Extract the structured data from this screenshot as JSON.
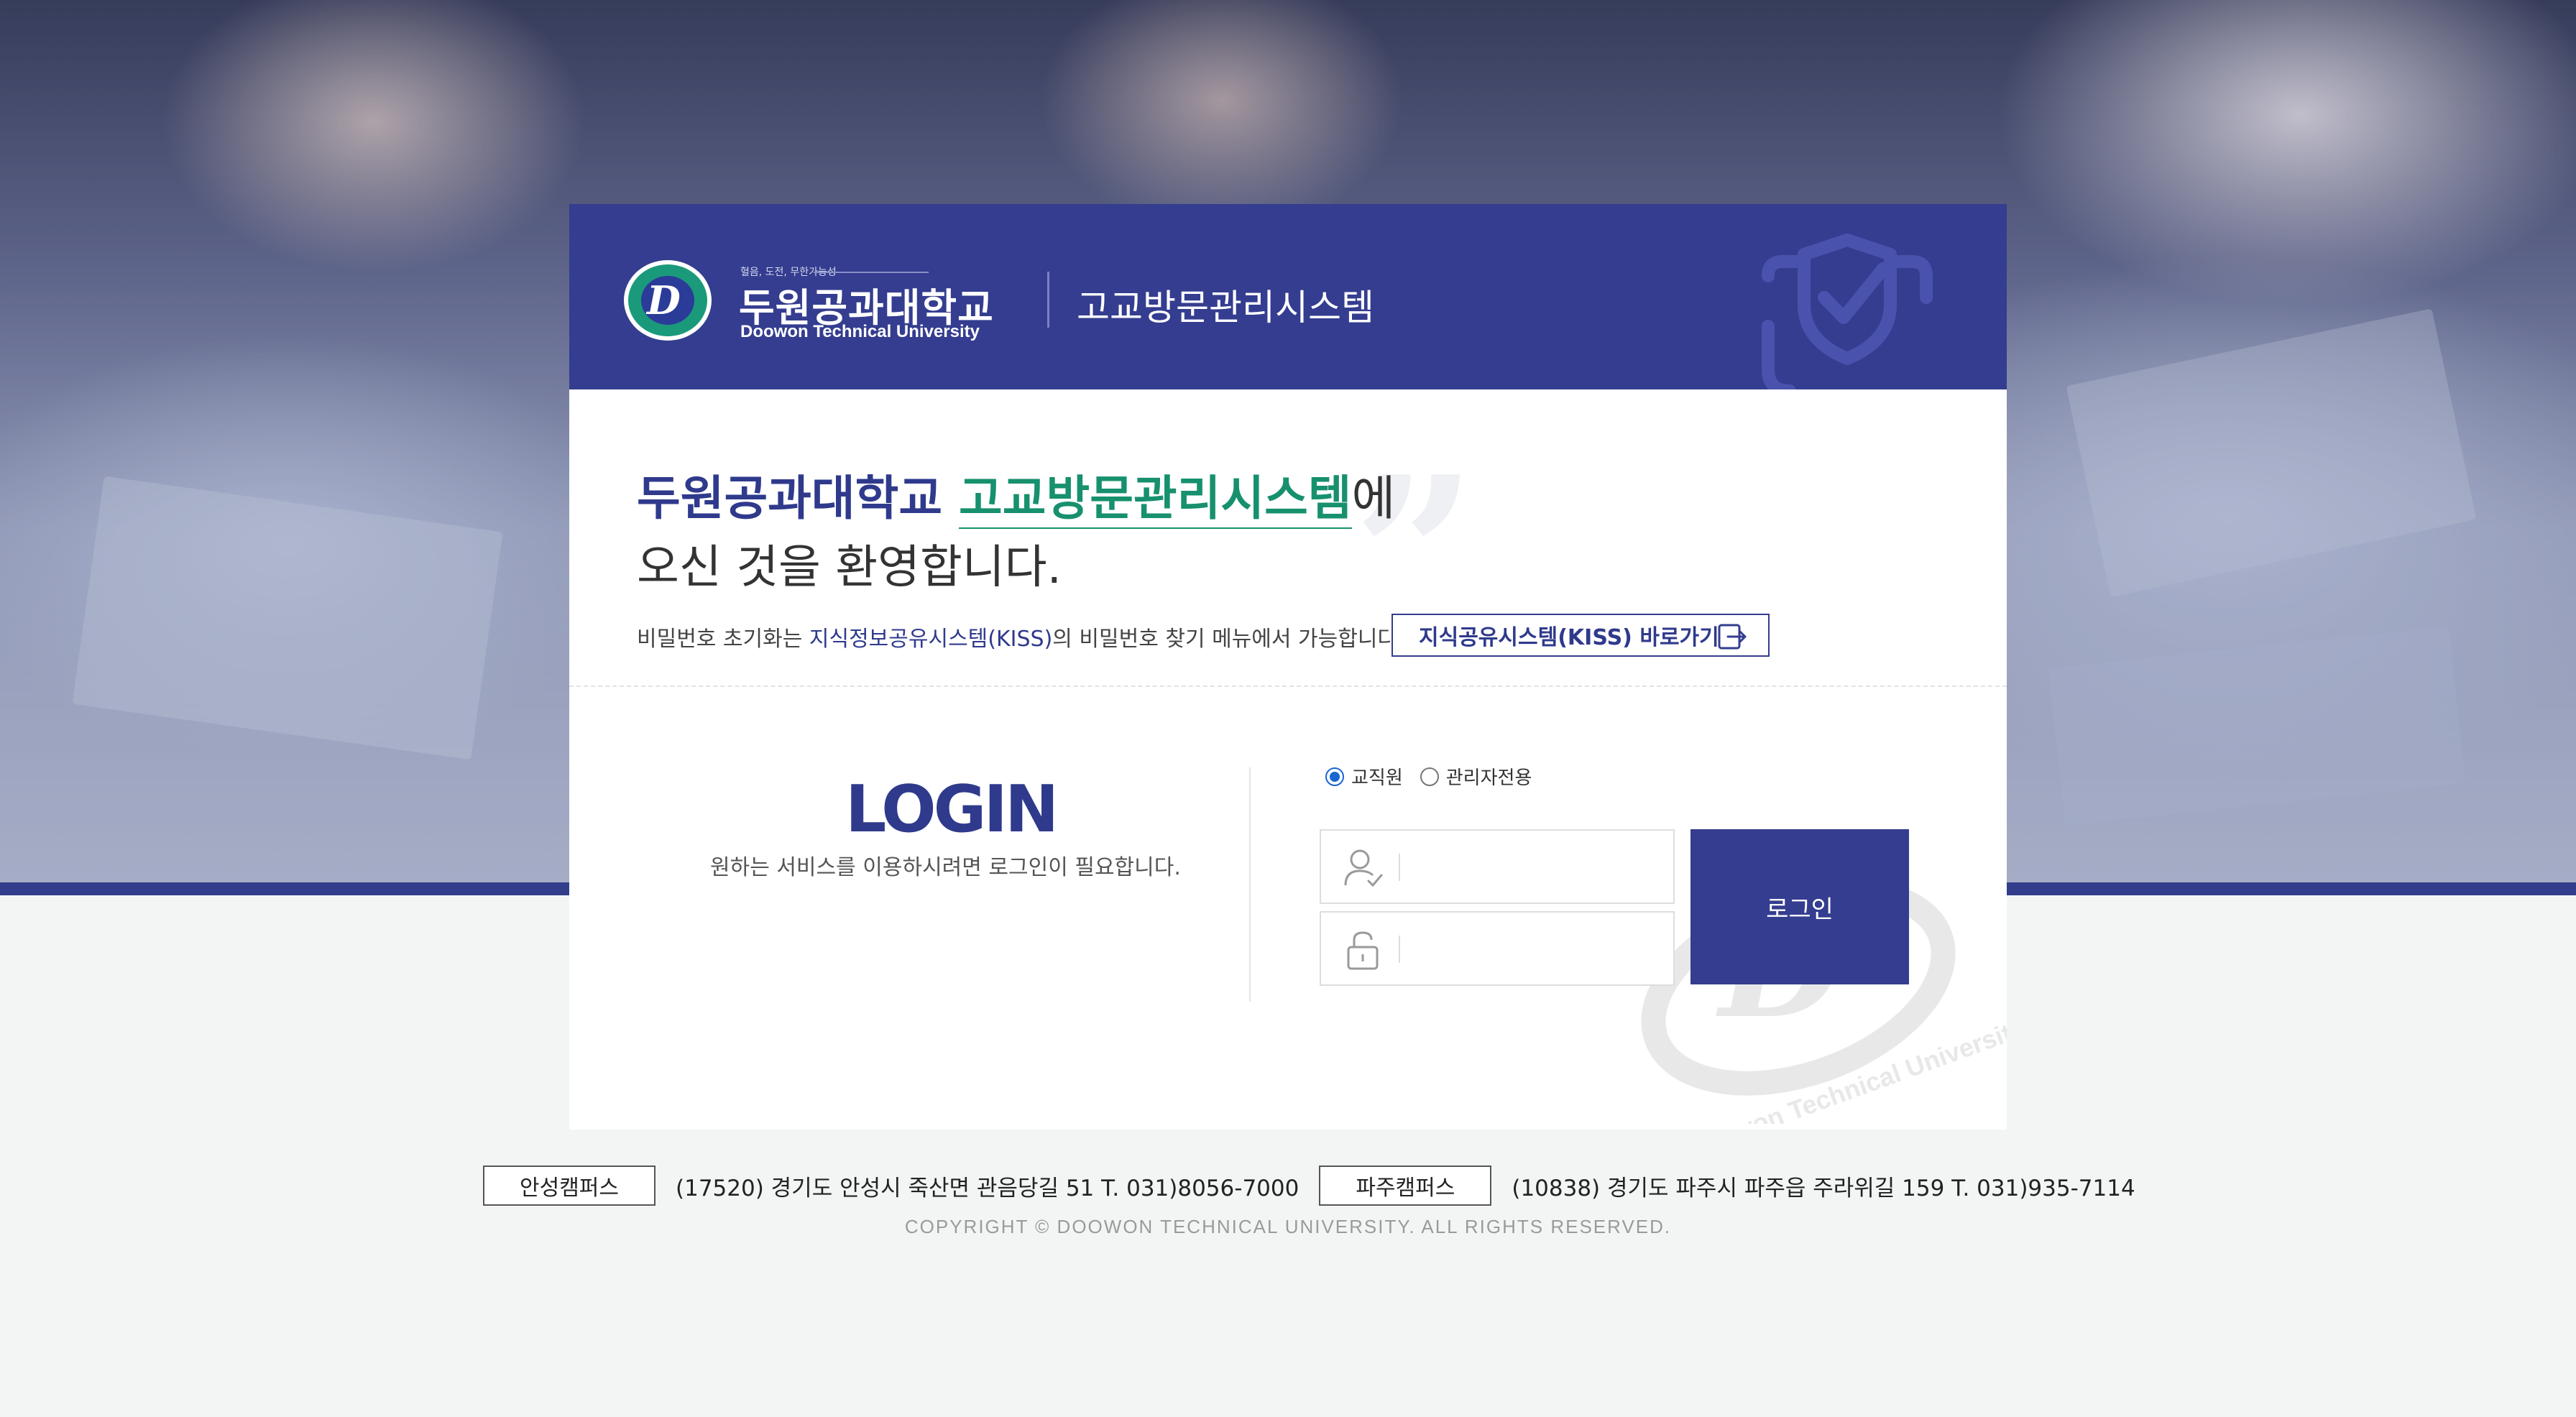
{
  "header": {
    "slogan": "혈음, 도전, 무한가능성",
    "university_kor": "두원공과대학교",
    "university_eng": "Doowon Technical University",
    "system_name": "고교방문관리시스템"
  },
  "welcome": {
    "university": "두원공과대학교",
    "system": "고교방문관리시스템",
    "suffix": "에",
    "line2": "오신 것을 환영합니다.",
    "notice_prefix": "비밀번호 초기화는 ",
    "notice_link": "지식정보공유시스템(KISS)",
    "notice_suffix": "의 비밀번호 찾기 메뉴에서 가능합니다.",
    "kiss_button": "지식공유시스템(KISS) 바로가기"
  },
  "login": {
    "title": "LOGIN",
    "subtitle": "원하는 서비스를 이용하시려면 로그인이 필요합니다.",
    "radio_options": [
      "교직원",
      "관리자전용"
    ],
    "radio_selected": "교직원",
    "id_placeholder": "",
    "pw_placeholder": "",
    "button": "로그인"
  },
  "footer": {
    "campus1_name": "안성캠퍼스",
    "campus1_address": "(17520) 경기도 안성시 죽산면 관음당길 51 T. 031)8056-7000",
    "campus2_name": "파주캠퍼스",
    "campus2_address": "(10838) 경기도 파주시 파주읍 주라위길 159 T. 031)935-7114",
    "copyright": "COPYRIGHT © DOOWON TECHNICAL UNIVERSITY. ALL RIGHTS RESERVED."
  },
  "colors": {
    "brand_navy": "#343d8f",
    "accent_green": "#17906e",
    "radio_blue": "#1a66d2"
  },
  "icons": [
    "shield-check-icon",
    "exit-icon",
    "user-icon",
    "lock-icon",
    "university-logo"
  ]
}
